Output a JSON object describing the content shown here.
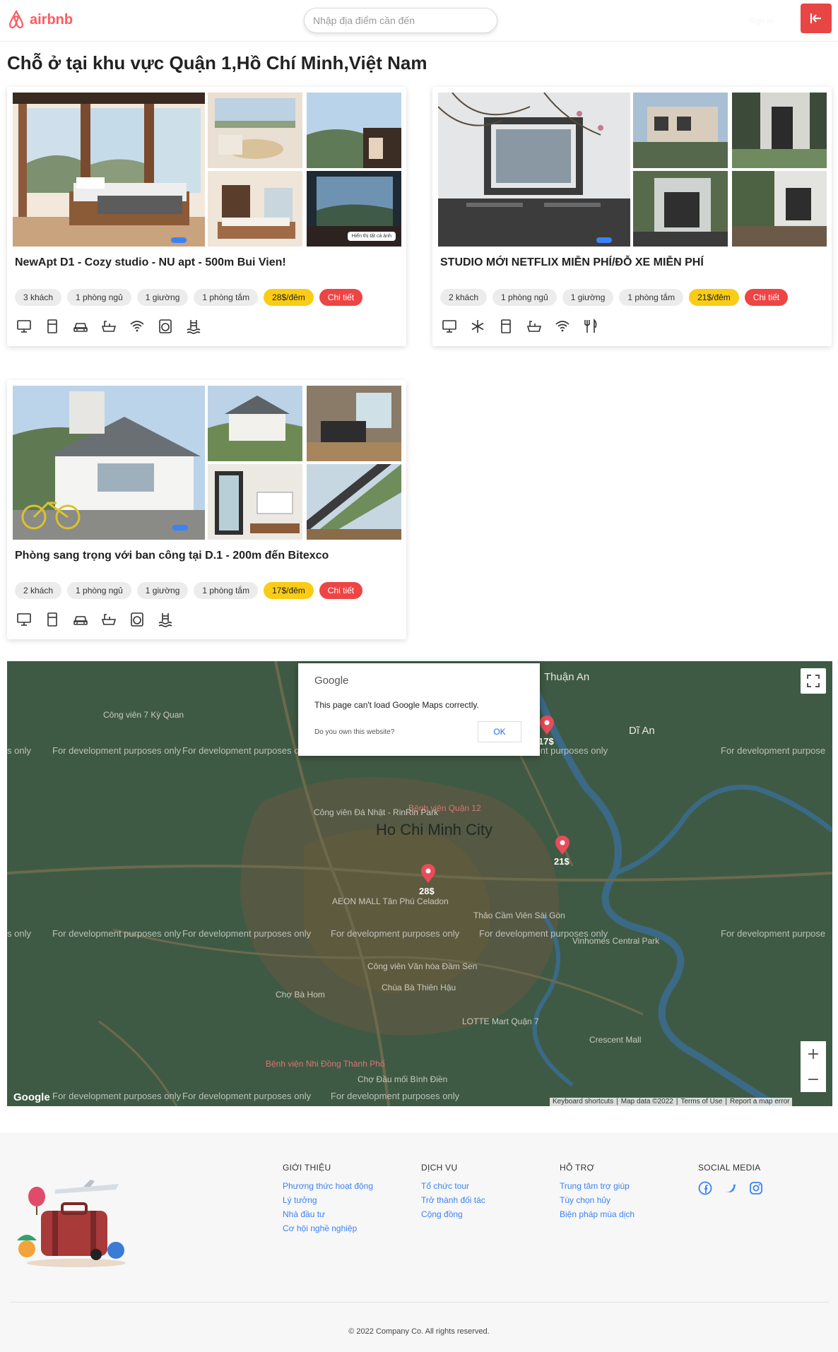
{
  "header": {
    "brand": "airbnb",
    "search_placeholder": "Nhập địa điểm cần đến",
    "signin": "Sign in"
  },
  "page_title": "Chỗ ở tại khu vực Quận 1,Hồ Chí Minh,Việt Nam",
  "listings": [
    {
      "title": "NewApt D1 - Cozy studio - NU apt - 500m Bui Vien!",
      "guests": "3 khách",
      "bedrooms": "1 phòng ngủ",
      "beds": "1 giường",
      "baths": "1 phòng tắm",
      "price": "28$/đêm",
      "detail": "Chi tiết",
      "show_all": "Hiển thị tất cả ảnh",
      "amenities": [
        "tv-icon",
        "fridge-icon",
        "car-icon",
        "bathtub-icon",
        "wifi-icon",
        "washer-icon",
        "pool-icon"
      ]
    },
    {
      "title": "STUDIO MỚI NETFLIX MIỄN PHÍ/ĐỖ XE MIỄN PHÍ",
      "guests": "2 khách",
      "bedrooms": "1 phòng ngủ",
      "beds": "1 giường",
      "baths": "1 phòng tắm",
      "price": "21$/đêm",
      "detail": "Chi tiết",
      "amenities": [
        "tv-icon",
        "snowflake-icon",
        "fridge-icon",
        "bathtub-icon",
        "wifi-icon",
        "kitchen-icon"
      ]
    },
    {
      "title": "Phòng sang trọng với ban công tại D.1 - 200m đến Bitexco",
      "guests": "2 khách",
      "bedrooms": "1 phòng ngủ",
      "beds": "1 giường",
      "baths": "1 phòng tắm",
      "price": "17$/đêm",
      "detail": "Chi tiết",
      "amenities": [
        "tv-icon",
        "fridge-icon",
        "car-icon",
        "bathtub-icon",
        "washer-icon",
        "pool-icon"
      ]
    }
  ],
  "map": {
    "error_brand": "Google",
    "error_message": "This page can't load Google Maps correctly.",
    "own_question": "Do you own this website?",
    "ok": "OK",
    "watermark": "For development purposes only",
    "watermark_short": "s only",
    "watermark_cut": "For development purpose",
    "markers": [
      "17$",
      "28$",
      "21$"
    ],
    "places": {
      "thuan_an": "Thuận An",
      "di_an": "Dĩ An",
      "hcm": "Ho Chi Minh City",
      "benh_vien_quan_12": "Bệnh viện Quận 12",
      "cong_vien_7k": "Công viên 7 Kỳ Quan",
      "cong_vien_da_nhat": "Công viên Đá Nhật - RinRin Park",
      "aeon": "AEON MALL Tân Phú Celadon",
      "thao_cam_vien": "Thảo Cầm Viên Sài Gòn",
      "vinhomes": "Vinhomes Central Park",
      "lotte": "LOTTE Mart Quận 7",
      "crescent": "Crescent Mall",
      "cho_ba_hom": "Chợ Bà Hom",
      "cho_binh_dien": "Chợ Đầu mối Bình Điền",
      "benh_vien_nhi": "Bệnh viện Nhi Đồng Thành Phố",
      "cong_vien_van_hoa": "Công viên Văn hóa Đầm Sen",
      "chua_ba_thien_hau": "Chùa Bà Thiên Hậu"
    },
    "google": "Google",
    "attribution": [
      "Keyboard shortcuts",
      "Map data ©2022",
      "Terms of Use",
      "Report a map error"
    ]
  },
  "footer": {
    "col1": {
      "title": "GIỚI THIỆU",
      "links": [
        "Phương thức hoạt động",
        "Lý tưởng",
        "Nhà đầu tư",
        "Cơ hội nghề nghiệp"
      ]
    },
    "col2": {
      "title": "DỊCH VỤ",
      "links": [
        "Tổ chức tour",
        "Trở thành đối tác",
        "Cộng đồng"
      ]
    },
    "col3": {
      "title": "HỖ TRỢ",
      "links": [
        "Trung tâm trợ giúp",
        "Tùy chọn hủy",
        "Biện pháp mùa dịch"
      ]
    },
    "col4": {
      "title": "SOCIAL MEDIA",
      "icons": [
        "facebook-icon",
        "twitter-icon",
        "instagram-icon"
      ]
    },
    "copyright": "© 2022 Company Co. All rights reserved."
  },
  "colors": {
    "brand": "#ff5a5f",
    "accent_red": "#ef4444",
    "price_yellow": "#facc15",
    "link_blue": "#3b82f6"
  }
}
